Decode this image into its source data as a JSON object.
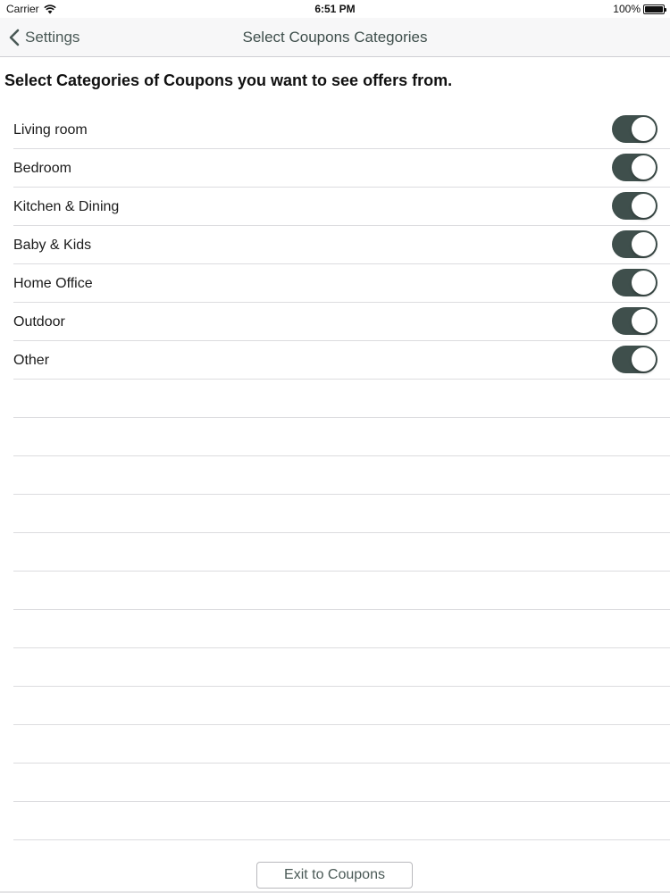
{
  "status_bar": {
    "carrier": "Carrier",
    "time": "6:51 PM",
    "battery": "100%"
  },
  "nav": {
    "back_label": "Settings",
    "title": "Select Coupons Categories"
  },
  "instructions": "Select Categories of Coupons you want to see offers from.",
  "categories": [
    {
      "label": "Living room",
      "enabled": true
    },
    {
      "label": "Bedroom",
      "enabled": true
    },
    {
      "label": "Kitchen & Dining",
      "enabled": true
    },
    {
      "label": "Baby & Kids",
      "enabled": true
    },
    {
      "label": "Home Office",
      "enabled": true
    },
    {
      "label": "Outdoor",
      "enabled": true
    },
    {
      "label": "Other",
      "enabled": true
    }
  ],
  "exit_button": "Exit to Coupons",
  "colors": {
    "accent": "#3f4f4c",
    "toggle_on": "#3f4f4c",
    "nav_background": "#f7f7f8"
  }
}
